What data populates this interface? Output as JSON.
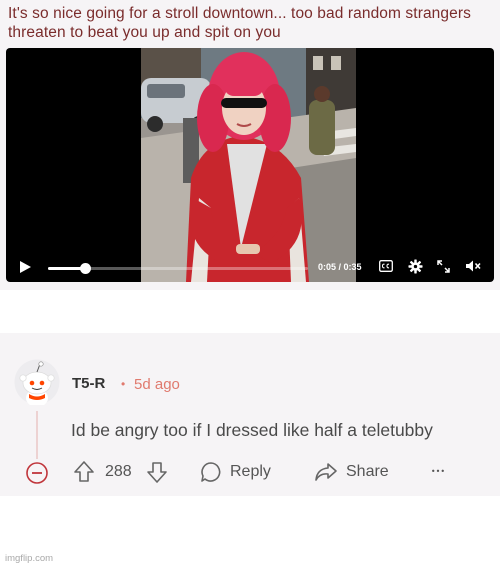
{
  "post": {
    "title": "It's so nice going for a stroll downtown... too bad random strangers threaten to beat you up and spit on you"
  },
  "video": {
    "time_readout": "0:05 / 0:35",
    "progress": 0.143,
    "icons": [
      "play-icon",
      "captions-icon",
      "gear-icon",
      "expand-icon",
      "mute-icon"
    ]
  },
  "comment": {
    "username": "T5-R",
    "separator": "•",
    "timestamp": "5d ago",
    "body": "Id be angry too if I dressed like half a teletubby",
    "vote_count": "288",
    "reply_label": "Reply",
    "share_label": "Share",
    "more_label": "•••"
  },
  "colors": {
    "title_text": "#7a2c2c",
    "timestamp": "#e07a6e",
    "collapse_icon": "#c0353b",
    "card_background": "#f6f4f6"
  },
  "watermark": "imgflip.com"
}
